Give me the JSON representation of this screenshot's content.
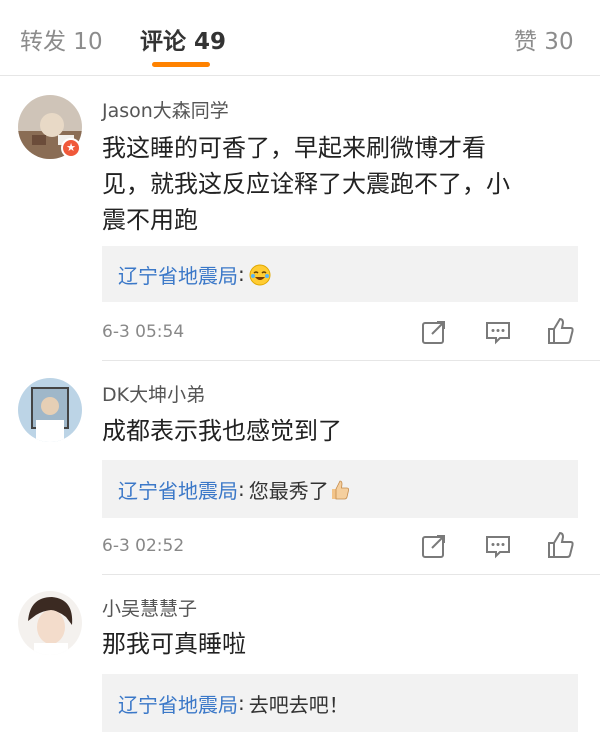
{
  "tabs": [
    {
      "label": "转发 10"
    },
    {
      "label": "评论 49"
    },
    {
      "label": "赞 30"
    }
  ],
  "colors": {
    "accent": "#ff8200",
    "reply_name": "#3b78c8",
    "reply_bg": "#f2f2f2"
  },
  "comments": [
    {
      "username": "Jason大森同学",
      "lines": [
        "我这睡的可香了，早起来刷微博才看",
        "见，就我这反应诠释了大震跑不了，小",
        "震不用跑"
      ],
      "reply": {
        "name": "辽宁省地震局",
        "sep": ":",
        "text": "",
        "emoji": "laughing-tears-emoji"
      },
      "time": "6-3 05:54"
    },
    {
      "username": "DK大坤小弟",
      "lines": [
        "成都表示我也感觉到了"
      ],
      "reply": {
        "name": "辽宁省地震局",
        "sep": ":",
        "text": "您最秀了",
        "emoji": "thumbs-up-emoji"
      },
      "time": "6-3 02:52"
    },
    {
      "username": "小吴慧慧子",
      "lines": [
        "那我可真睡啦"
      ],
      "reply": {
        "name": "辽宁省地震局",
        "sep": ":",
        "text": "去吧去吧！",
        "emoji": ""
      }
    }
  ]
}
